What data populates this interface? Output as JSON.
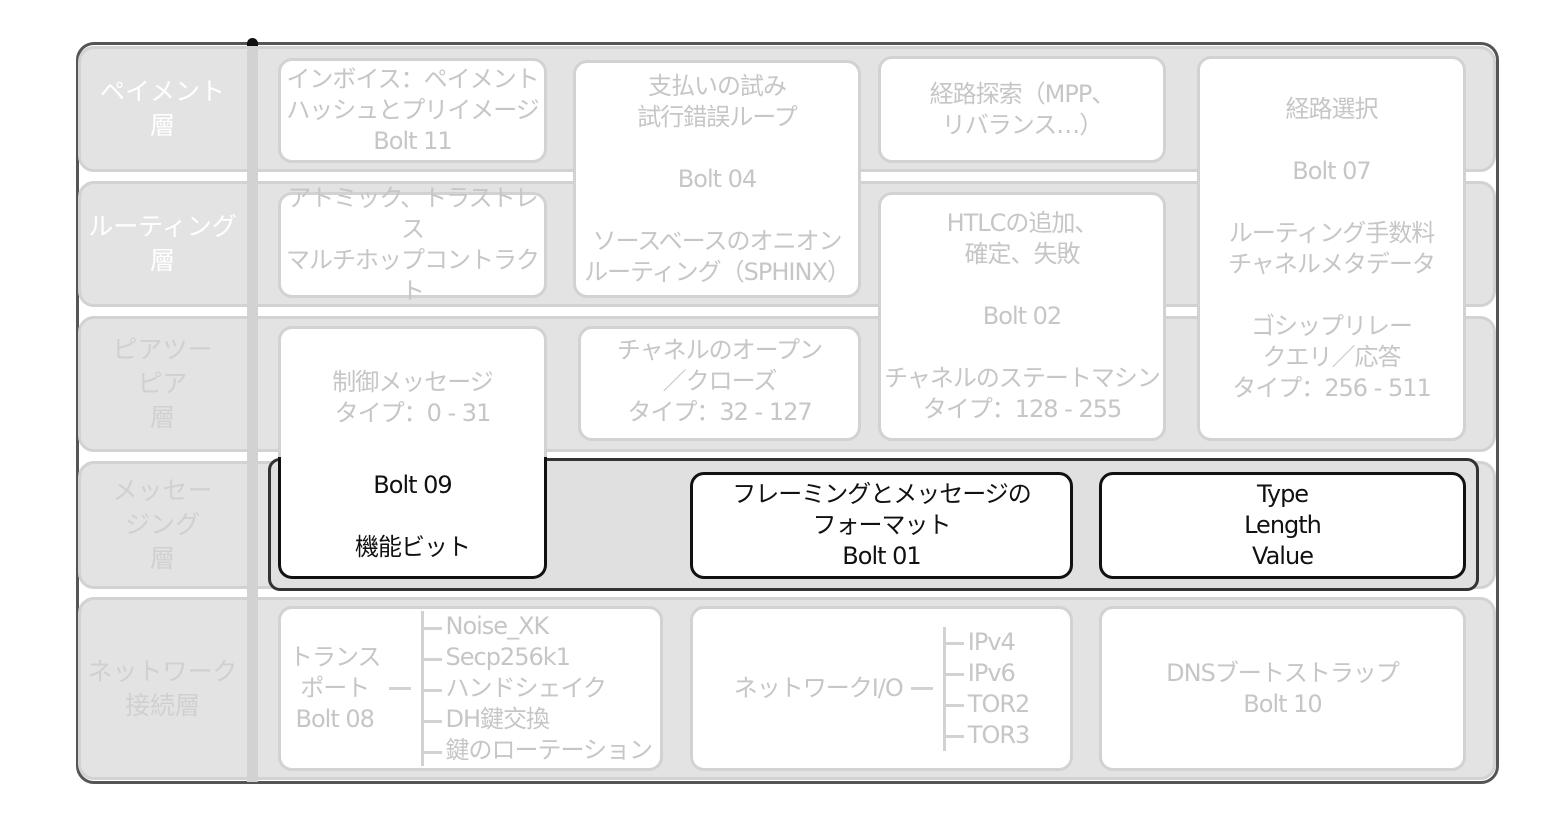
{
  "layers": {
    "payment": "ペイメント\n層",
    "routing": "ルーティング\n層",
    "peer": "ピアツー\nピア\n層",
    "messaging": "メッセー\nジング\n層",
    "network": "ネットワーク\n接続層"
  },
  "boxes": {
    "invoice": [
      "インボイス：ペイメント",
      "ハッシュとプリイメージ",
      "Bolt 11"
    ],
    "payment_attempt": [
      "支払いの試み",
      "試行錯誤ループ",
      "",
      "Bolt 04",
      "",
      "ソースベースのオニオン",
      "ルーティング（SPHINX）"
    ],
    "path_finding": [
      "経路探索（MPP、",
      "リバランス…）"
    ],
    "route_selection": [
      "経路選択",
      "",
      "Bolt 07",
      "",
      "ルーティング手数料",
      "チャネルメタデータ",
      "",
      "ゴシップリレー",
      "クエリ／応答",
      "タイプ：256 - 511"
    ],
    "atomic": [
      "アトミック、トラストレス",
      "マルチホップコントラクト"
    ],
    "htlc": [
      "HTLCの追加、",
      "確定、失敗",
      "",
      "Bolt 02",
      "",
      "チャネルのステートマシン",
      "タイプ：128 - 255"
    ],
    "control": [
      "制御メッセージ",
      "タイプ：0 - 31"
    ],
    "channel_open": [
      "チャネルのオープン",
      "／クローズ",
      "タイプ：32 - 127"
    ],
    "features": [
      "Bolt 09",
      "",
      "機能ビット"
    ],
    "framing": [
      "フレーミングとメッセージの",
      "フォーマット",
      "Bolt 01"
    ],
    "tlv": [
      "Type",
      "Length",
      "Value"
    ],
    "transport": {
      "title": [
        "トランス",
        "ポート",
        "Bolt 08"
      ],
      "items": [
        "Noise_XK",
        "Secp256k1",
        "ハンドシェイク",
        "DH鍵交換",
        "鍵のローテーション"
      ]
    },
    "network_io": {
      "title": "ネットワークI/O",
      "items": [
        "IPv4",
        "IPv6",
        "TOR2",
        "TOR3"
      ]
    },
    "dns": [
      "DNSブートストラップ",
      "Bolt 10"
    ]
  },
  "colors": {
    "highlight_border": "#111111",
    "faded_text": "#c6c6c6",
    "band": "#e3e3e3"
  }
}
